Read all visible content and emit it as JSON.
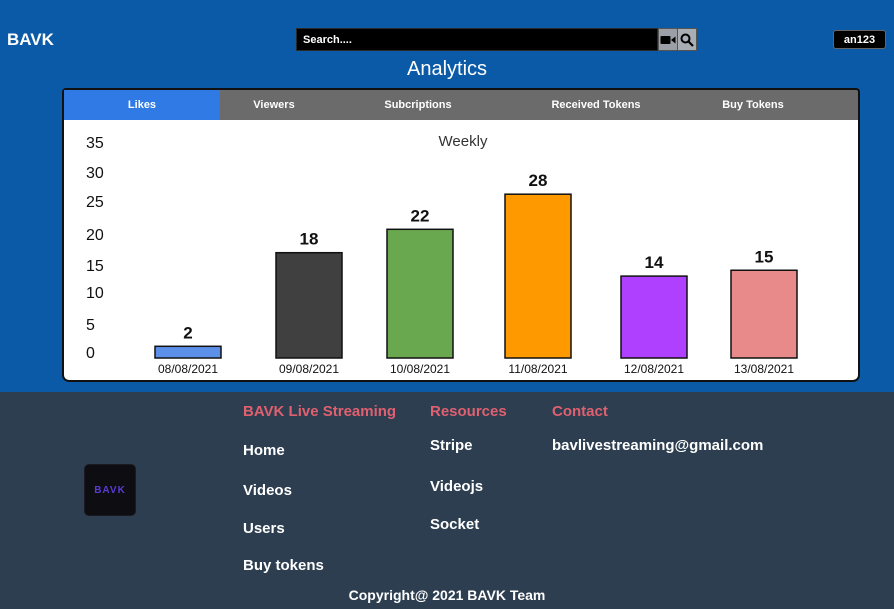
{
  "header": {
    "brand": "BAVK",
    "search_placeholder": "Search....",
    "video_icon": "video-camera-icon",
    "search_icon": "magnifier-icon",
    "user": "an123"
  },
  "page": {
    "title": "Analytics"
  },
  "tabs": [
    {
      "label": "Likes",
      "active": true
    },
    {
      "label": "Viewers",
      "active": false
    },
    {
      "label": "Subcriptions",
      "active": false
    },
    {
      "label": "Received Tokens",
      "active": false
    },
    {
      "label": "Buy Tokens",
      "active": false
    }
  ],
  "chart_data": {
    "type": "bar",
    "title": "Weekly",
    "categories": [
      "08/08/2021",
      "09/08/2021",
      "10/08/2021",
      "11/08/2021",
      "12/08/2021",
      "13/08/2021"
    ],
    "values": [
      2,
      18,
      22,
      28,
      14,
      15
    ],
    "colors": [
      "#5b8fe8",
      "#404040",
      "#6aa84f",
      "#ff9900",
      "#b040ff",
      "#e88a8a"
    ],
    "y_ticks": [
      "35",
      "30",
      "25",
      "20",
      "15",
      "10",
      "5",
      "0"
    ],
    "ylim": [
      0,
      35
    ],
    "grid": false
  },
  "footer": {
    "logo_text": "BAVK",
    "col1_title": "BAVK Live Streaming",
    "col1_links": [
      "Home",
      "Videos",
      "Users",
      "Buy tokens"
    ],
    "col2_title": "Resources",
    "col2_links": [
      "Stripe",
      "Videojs",
      "Socket"
    ],
    "col3_title": "Contact",
    "email": "bavlivestreaming@gmail.com",
    "copyright": "Copyright@ 2021 BAVK Team"
  }
}
